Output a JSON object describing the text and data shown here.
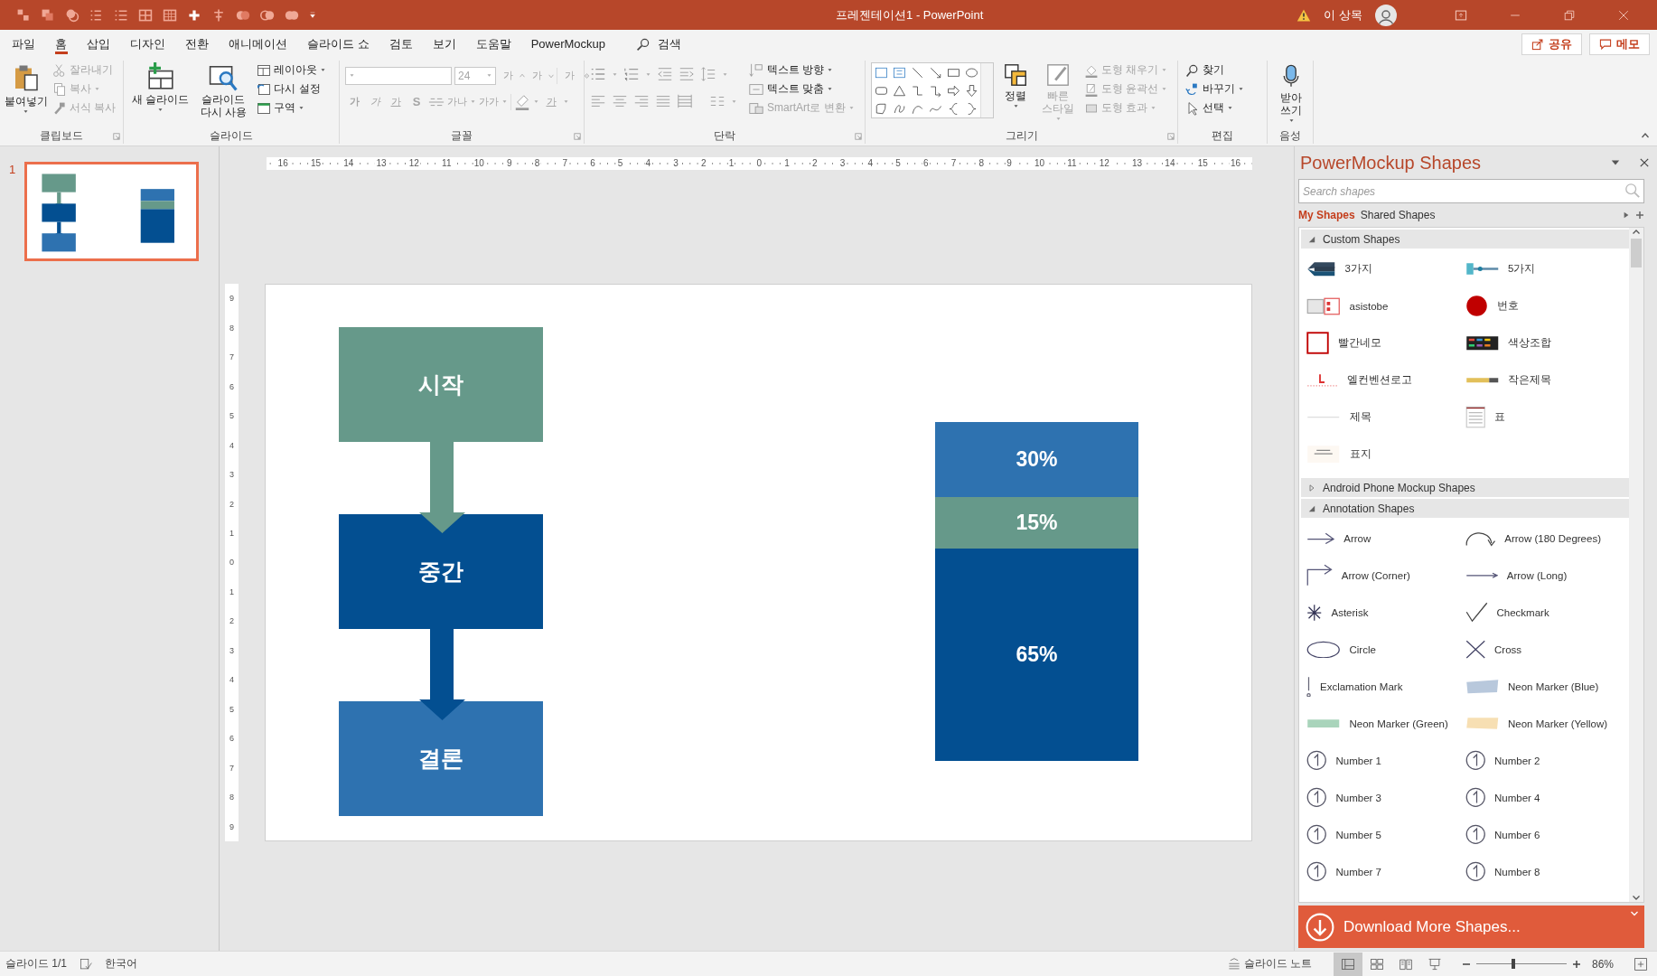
{
  "title_bar": {
    "title": "프레젠테이션1  -  PowerPoint",
    "user": "이 상목"
  },
  "menu_tabs": [
    {
      "label": "파일",
      "selected": false
    },
    {
      "label": "홈",
      "selected": true
    },
    {
      "label": "삽입",
      "selected": false
    },
    {
      "label": "디자인",
      "selected": false
    },
    {
      "label": "전환",
      "selected": false
    },
    {
      "label": "애니메이션",
      "selected": false
    },
    {
      "label": "슬라이드 쇼",
      "selected": false
    },
    {
      "label": "검토",
      "selected": false
    },
    {
      "label": "보기",
      "selected": false
    },
    {
      "label": "도움말",
      "selected": false
    },
    {
      "label": "PowerMockup",
      "selected": false
    }
  ],
  "search_label": "검색",
  "share_button": "공유",
  "comments_button": "메모",
  "ribbon": {
    "groups": [
      {
        "label": "클립보드",
        "buttons": [
          {
            "label": "붙여넣기",
            "disabled": false
          },
          {
            "label": "잘라내기",
            "disabled": true
          },
          {
            "label": "복사",
            "disabled": true
          },
          {
            "label": "서식 복사",
            "disabled": true
          }
        ]
      },
      {
        "label": "슬라이드",
        "buttons": [
          {
            "label": "새 슬라이드",
            "disabled": false
          },
          {
            "label": "슬라이드 다시 사용",
            "disabled": false
          },
          {
            "label": "레이아웃",
            "disabled": false
          },
          {
            "label": "다시 설정",
            "disabled": false
          },
          {
            "label": "구역",
            "disabled": false
          }
        ]
      },
      {
        "label": "글꼴",
        "font_size": "24",
        "buttons": [
          {
            "label": "가",
            "disabled": true
          },
          {
            "label": "가",
            "disabled": true
          },
          {
            "label": "가",
            "disabled": true
          },
          {
            "label": "가",
            "disabled": true
          },
          {
            "label": "가",
            "disabled": true
          },
          {
            "label": "가",
            "disabled": true
          },
          {
            "label": "S",
            "disabled": true
          },
          {
            "label": "가나",
            "disabled": true
          },
          {
            "label": "가가",
            "disabled": true
          },
          {
            "label": "가",
            "disabled": true
          }
        ]
      },
      {
        "label": "단락",
        "buttons": [
          {
            "label": "텍스트 방향",
            "disabled": false
          },
          {
            "label": "텍스트 맞춤",
            "disabled": false
          },
          {
            "label": "SmartArt로 변환",
            "disabled": true
          }
        ]
      },
      {
        "label": "그리기",
        "buttons": [
          {
            "label": "정렬",
            "disabled": false
          },
          {
            "label": "빠른 스타일",
            "disabled": true
          },
          {
            "label": "도형 채우기",
            "disabled": true
          },
          {
            "label": "도형 윤곽선",
            "disabled": true
          },
          {
            "label": "도형 효과",
            "disabled": true
          }
        ]
      },
      {
        "label": "편집",
        "buttons": [
          {
            "label": "찾기",
            "disabled": false
          },
          {
            "label": "바꾸기",
            "disabled": false
          },
          {
            "label": "선택",
            "disabled": false
          }
        ]
      },
      {
        "label": "음성",
        "buttons": [
          {
            "label": "받아 쓰기",
            "disabled": false
          }
        ]
      }
    ]
  },
  "thumbnails": [
    {
      "number": "1",
      "selected": true
    }
  ],
  "rulers": {
    "horizontal": [
      "16",
      "15",
      "14",
      "13",
      "12",
      "11",
      "10",
      "9",
      "8",
      "7",
      "6",
      "5",
      "4",
      "3",
      "2",
      "1",
      "0",
      "1",
      "2",
      "3",
      "4",
      "5",
      "6",
      "7",
      "8",
      "9",
      "10",
      "11",
      "12",
      "13",
      "14",
      "15",
      "16"
    ],
    "vertical": [
      "9",
      "8",
      "7",
      "6",
      "5",
      "4",
      "3",
      "2",
      "1",
      "0",
      "1",
      "2",
      "3",
      "4",
      "5",
      "6",
      "7",
      "8",
      "9"
    ]
  },
  "slide": {
    "flow": [
      {
        "label": "시작",
        "color": "#66998a"
      },
      {
        "label": "중간",
        "color": "#034f91"
      },
      {
        "label": "결론",
        "color": "#2e72b0"
      }
    ],
    "stack": [
      {
        "label": "30%",
        "color": "#2e72b0"
      },
      {
        "label": "15%",
        "color": "#66998a"
      },
      {
        "label": "65%",
        "color": "#034f91"
      }
    ]
  },
  "pane": {
    "title": "PowerMockup Shapes",
    "search": {
      "placeholder": "Search shapes"
    },
    "tabs": [
      {
        "label": "My Shapes",
        "selected": true
      },
      {
        "label": "Shared Shapes",
        "selected": false
      }
    ],
    "sections": [
      {
        "title": "Custom Shapes",
        "expanded": true,
        "items": [
          "3가지",
          "5가지",
          "asistobe",
          "번호",
          "빨간네모",
          "색상조합",
          "엘컨벤션로고",
          "작은제목",
          "제목",
          "표",
          "표지"
        ]
      },
      {
        "title": "Android Phone Mockup Shapes",
        "expanded": false
      },
      {
        "title": "Annotation Shapes",
        "expanded": true,
        "items": [
          "Arrow",
          "Arrow (180 Degrees)",
          "Arrow (Corner)",
          "Arrow (Long)",
          "Asterisk",
          "Checkmark",
          "Circle",
          "Cross",
          "Exclamation Mark",
          "Neon Marker (Blue)",
          "Neon Marker (Green)",
          "Neon Marker (Yellow)",
          "Number 1",
          "Number 2",
          "Number 3",
          "Number 4",
          "Number 5",
          "Number 6",
          "Number 7",
          "Number 8"
        ]
      }
    ],
    "download_button": "Download More Shapes..."
  },
  "status_bar": {
    "slide_counter": "슬라이드 1/1",
    "language": "한국어",
    "notes_button": "슬라이드 노트",
    "views": [
      {
        "selected": true
      },
      {
        "selected": false
      },
      {
        "selected": false
      },
      {
        "selected": false
      }
    ],
    "zoom": {
      "level": 0.41,
      "reading": "86%"
    }
  }
}
